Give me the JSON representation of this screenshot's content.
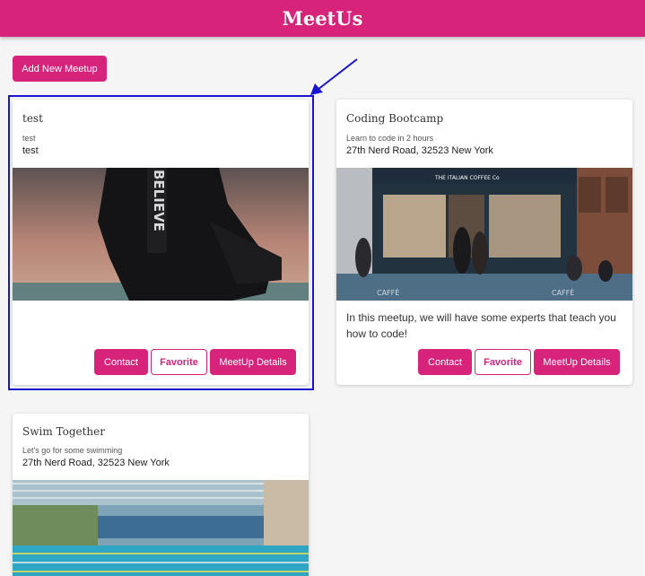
{
  "app": {
    "title": "MeetUs"
  },
  "toolbar": {
    "add_label": "Add New Meetup"
  },
  "cards": [
    {
      "title": "test",
      "subtitle": "test",
      "address": "test",
      "description": "",
      "buttons": {
        "contact": "Contact",
        "favorite": "Favorite",
        "details": "MeetUp Details"
      }
    },
    {
      "title": "Coding Bootcamp",
      "subtitle": "Learn to code in 2 hours",
      "address": "27th Nerd Road, 32523 New York",
      "description": "In this meetup, we will have some experts that teach you how to code!",
      "image_text": {
        "awning": "THE ITALIAN COFFEE Co",
        "sign": "CAFFÈ"
      },
      "buttons": {
        "contact": "Contact",
        "favorite": "Favorite",
        "details": "MeetUp Details"
      }
    },
    {
      "title": "Swim Together",
      "subtitle": "Let's go for some swimming",
      "address": "27th Nerd Road, 32523 New York"
    }
  ],
  "colors": {
    "brand": "#d8237a",
    "highlight": "#1a14d0",
    "background": "#f5f5f5"
  }
}
